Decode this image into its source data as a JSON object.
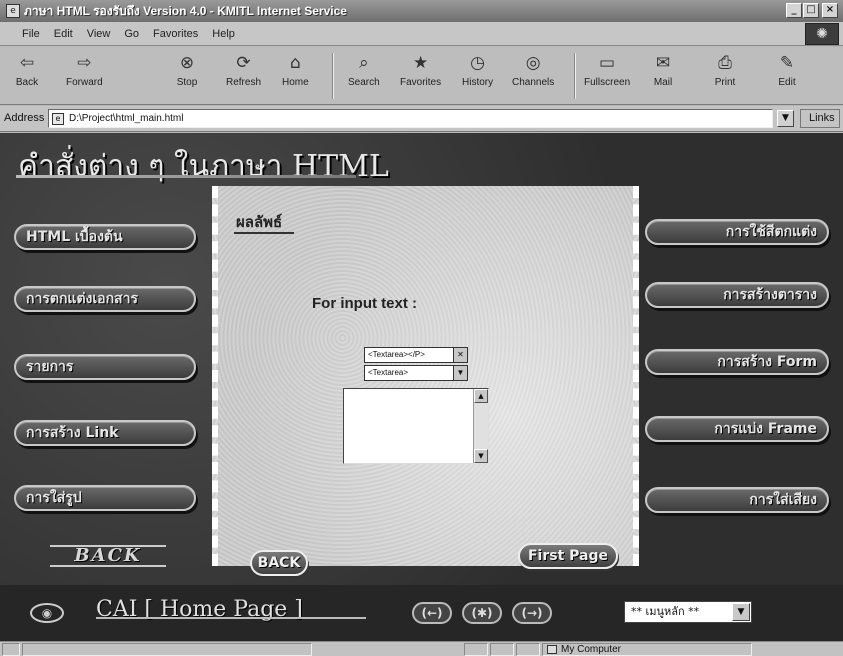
{
  "window": {
    "title": "ภาษา HTML รองรับถึง Version 4.0 - KMITL Internet Service",
    "minimize": "_",
    "maximize": "□",
    "close": "×"
  },
  "menu": [
    "File",
    "Edit",
    "View",
    "Go",
    "Favorites",
    "Help"
  ],
  "toolbar": [
    {
      "label": "Back",
      "icon": "back-arrow-icon",
      "glyph": "⇦"
    },
    {
      "label": "Forward",
      "icon": "forward-arrow-icon",
      "glyph": "⇨"
    },
    {
      "label": "Stop",
      "icon": "stop-icon",
      "glyph": "⊗"
    },
    {
      "label": "Refresh",
      "icon": "refresh-icon",
      "glyph": "⟳"
    },
    {
      "label": "Home",
      "icon": "home-icon",
      "glyph": "⌂"
    },
    {
      "label": "Search",
      "icon": "search-icon",
      "glyph": "⌕"
    },
    {
      "label": "Favorites",
      "icon": "favorites-icon",
      "glyph": "★"
    },
    {
      "label": "History",
      "icon": "history-icon",
      "glyph": "◷"
    },
    {
      "label": "Channels",
      "icon": "channels-icon",
      "glyph": "◎"
    },
    {
      "label": "Fullscreen",
      "icon": "fullscreen-icon",
      "glyph": "▭"
    },
    {
      "label": "Mail",
      "icon": "mail-icon",
      "glyph": "✉"
    },
    {
      "label": "Print",
      "icon": "print-icon",
      "glyph": "⎙"
    },
    {
      "label": "Edit",
      "icon": "edit-icon",
      "glyph": "✎"
    }
  ],
  "address": {
    "label": "Address",
    "value": "D:\\Project\\html_main.html",
    "links": "Links"
  },
  "page": {
    "heading": "คำสั่งต่าง ๆ ในภาษา HTML",
    "left_buttons": [
      "HTML เบื้องต้น",
      "การตกแต่งเอกสาร",
      "รายการ",
      "การสร้าง Link",
      "การใส่รูป"
    ],
    "right_buttons": [
      "การใช้สีตกแต่ง",
      "การสร้างตาราง",
      "การสร้าง Form",
      "การแบ่ง Frame",
      "การใส่เสียง"
    ],
    "left_back": "BACK",
    "result_label": "ผลลัพธ์",
    "input_caption": "For input text :",
    "select_options": [
      "<Textarea></P>",
      "<Textarea>"
    ],
    "back_button": "BACK",
    "first_page_button": "First Page",
    "bottom_title": "CAI [ Home Page ]",
    "nav_prev": "(←)",
    "nav_home": "(✱)",
    "nav_next": "(→)",
    "menu_select": "** เมนูหลัก **"
  },
  "status": {
    "zone": "My Computer"
  }
}
